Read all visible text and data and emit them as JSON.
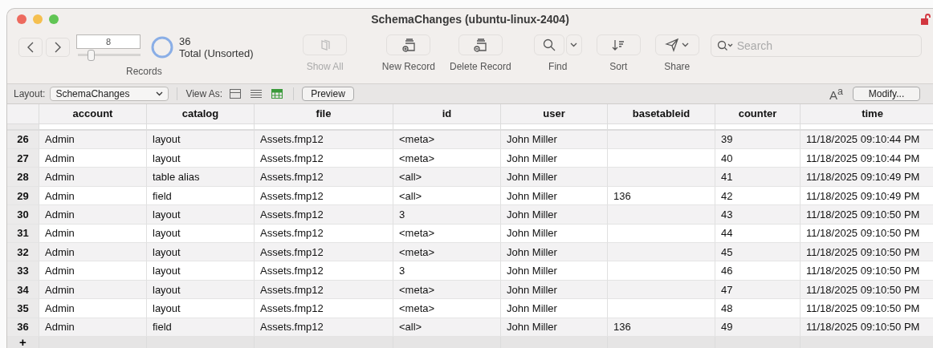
{
  "window": {
    "title": "SchemaChanges (ubuntu-linux-2404)"
  },
  "records": {
    "current": "8",
    "level": 0.22,
    "count": "36",
    "status": "Total (Unsorted)",
    "label": "Records"
  },
  "toolbar_buttons": [
    {
      "kind": "showall",
      "label": "Show All",
      "disabled": true
    },
    {
      "kind": "new",
      "label": "New Record",
      "disabled": false
    },
    {
      "kind": "delete",
      "label": "Delete Record",
      "disabled": false
    },
    {
      "kind": "find",
      "label": "Find",
      "disabled": false
    },
    {
      "kind": "sort",
      "label": "Sort",
      "disabled": false
    },
    {
      "kind": "share",
      "label": "Share",
      "disabled": false
    }
  ],
  "search": {
    "placeholder": "Search"
  },
  "layout_bar": {
    "layout_label": "Layout:",
    "layout": "SchemaChanges",
    "view_label": "View As:",
    "views": [
      {
        "kind": "form",
        "selected": false
      },
      {
        "kind": "list",
        "selected": false
      },
      {
        "kind": "table",
        "selected": true
      }
    ],
    "preview": "Preview",
    "text_size": "A$^{a}$",
    "modify": "Modify..."
  },
  "table": {
    "columns": [
      "account",
      "catalog",
      "file",
      "id",
      "user",
      "basetableid",
      "counter",
      "time"
    ],
    "rows": [
      {
        "n": "26",
        "cells": [
          "Admin",
          "layout",
          "Assets.fmp12",
          "<meta>",
          "John Miller",
          "",
          "39",
          "11/18/2025 09:10:44 PM"
        ]
      },
      {
        "n": "27",
        "cells": [
          "Admin",
          "layout",
          "Assets.fmp12",
          "<meta>",
          "John Miller",
          "",
          "40",
          "11/18/2025 09:10:44 PM"
        ]
      },
      {
        "n": "28",
        "cells": [
          "Admin",
          "table alias",
          "Assets.fmp12",
          "<all>",
          "John Miller",
          "",
          "41",
          "11/18/2025 09:10:49 PM"
        ]
      },
      {
        "n": "29",
        "cells": [
          "Admin",
          "field",
          "Assets.fmp12",
          "<all>",
          "John Miller",
          "136",
          "42",
          "11/18/2025 09:10:49 PM"
        ]
      },
      {
        "n": "30",
        "cells": [
          "Admin",
          "layout",
          "Assets.fmp12",
          "3",
          "John Miller",
          "",
          "43",
          "11/18/2025 09:10:50 PM"
        ]
      },
      {
        "n": "31",
        "cells": [
          "Admin",
          "layout",
          "Assets.fmp12",
          "<meta>",
          "John Miller",
          "",
          "44",
          "11/18/2025 09:10:50 PM"
        ]
      },
      {
        "n": "32",
        "cells": [
          "Admin",
          "layout",
          "Assets.fmp12",
          "<meta>",
          "John Miller",
          "",
          "45",
          "11/18/2025 09:10:50 PM"
        ]
      },
      {
        "n": "33",
        "cells": [
          "Admin",
          "layout",
          "Assets.fmp12",
          "3",
          "John Miller",
          "",
          "46",
          "11/18/2025 09:10:50 PM"
        ]
      },
      {
        "n": "34",
        "cells": [
          "Admin",
          "layout",
          "Assets.fmp12",
          "<meta>",
          "John Miller",
          "",
          "47",
          "11/18/2025 09:10:50 PM"
        ]
      },
      {
        "n": "35",
        "cells": [
          "Admin",
          "layout",
          "Assets.fmp12",
          "<meta>",
          "John Miller",
          "",
          "48",
          "11/18/2025 09:10:50 PM"
        ]
      },
      {
        "n": "36",
        "cells": [
          "Admin",
          "field",
          "Assets.fmp12",
          "<all>",
          "John Miller",
          "136",
          "49",
          "11/18/2025 09:10:50 PM"
        ]
      }
    ],
    "add_row": "+"
  }
}
